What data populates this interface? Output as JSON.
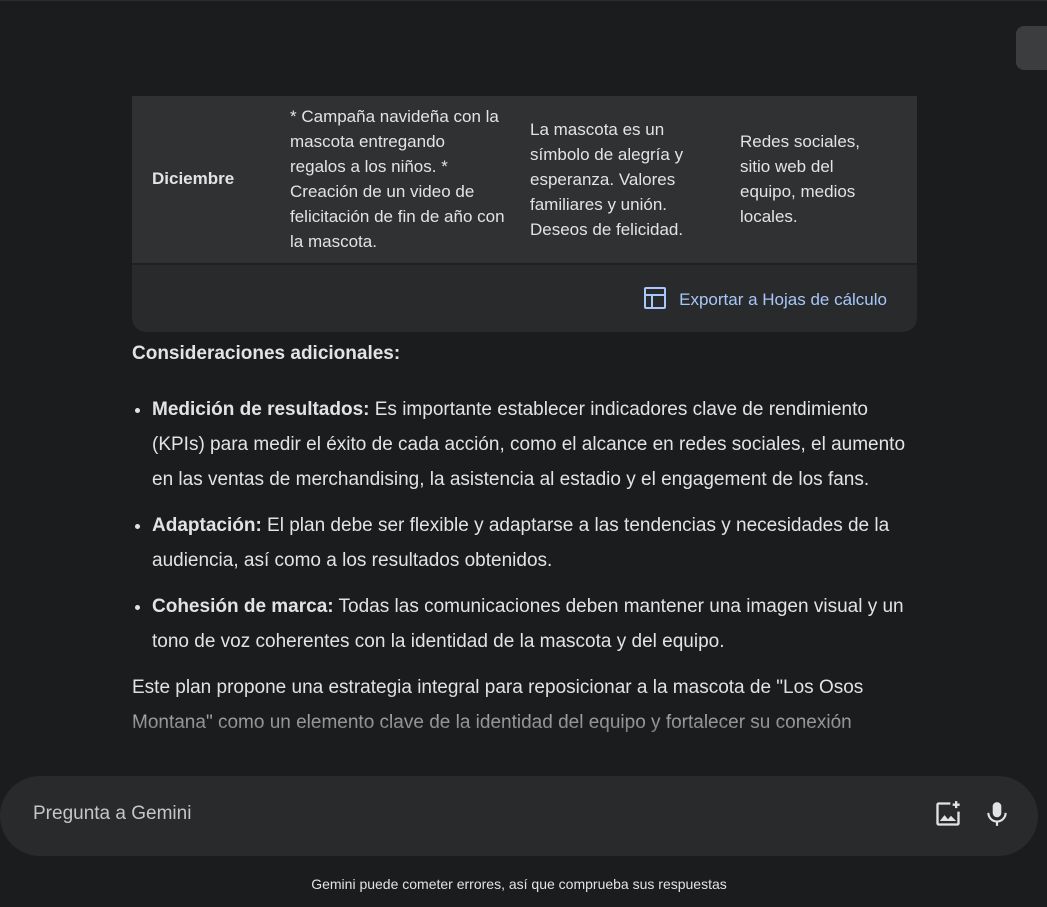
{
  "table": {
    "row": {
      "month": "Diciembre",
      "action": "* Campaña navideña con la mascota entregando regalos a los niños. * Creación de un video de felicitación de fin de año con la mascota.",
      "message": "La mascota es un símbolo de alegría y esperanza. Valores familiares y unión. Deseos de felicidad.",
      "channel": "Redes sociales, sitio web del equipo, medios locales."
    },
    "export_label": "Exportar a Hojas de cálculo"
  },
  "response": {
    "heading": "Consideraciones adicionales:",
    "items": [
      {
        "title": "Medición de resultados:",
        "text": " Es importante establecer indicadores clave de rendimiento (KPIs) para medir el éxito de cada acción, como el alcance en redes sociales, el aumento en las ventas de merchandising, la asistencia al estadio y el engagement de los fans."
      },
      {
        "title": "Adaptación:",
        "text": " El plan debe ser flexible y adaptarse a las tendencias y necesidades de la audiencia, así como a los resultados obtenidos."
      },
      {
        "title": "Cohesión de marca:",
        "text": " Todas las comunicaciones deben mantener una imagen visual y un tono de voz coherentes con la identidad de la mascota y del equipo."
      }
    ],
    "closing": "Este plan propone una estrategia integral para reposicionar a la mascota de \"Los Osos Montana\" como un elemento clave de la identidad del equipo y fortalecer su conexión"
  },
  "input": {
    "placeholder": "Pregunta a Gemini"
  },
  "footer": {
    "disclaimer": "Gemini puede cometer errores, así que comprueba sus respuestas"
  },
  "icons": {
    "export": "table-sheet-icon",
    "image_upload": "add-image-icon",
    "mic": "microphone-icon"
  },
  "colors": {
    "background": "#1b1c1d",
    "card": "#282a2c",
    "link": "#a8c7fa",
    "text": "#e3e3e3"
  }
}
